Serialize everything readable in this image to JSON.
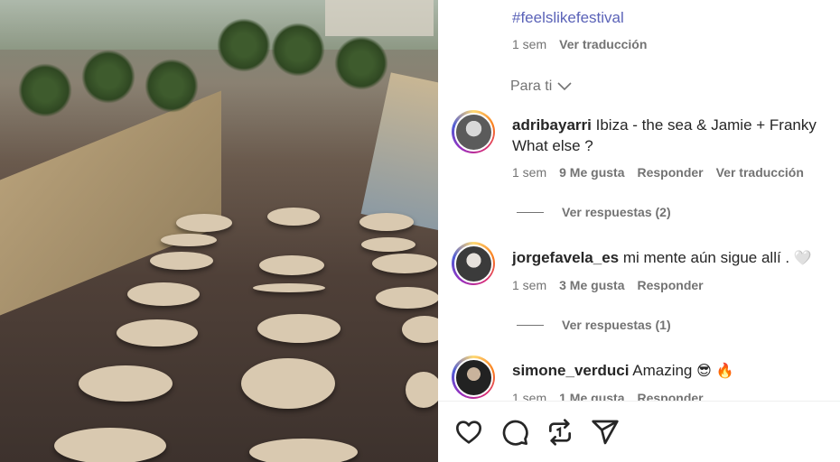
{
  "post": {
    "hashtag": "#feelslikefestival",
    "time": "1 sem",
    "see_translation": "Ver traducción"
  },
  "section_label": "Para ti",
  "comments": [
    {
      "user": "adribayarri",
      "text": "Ibiza - the sea & Jamie + Franky What else ?",
      "time": "1 sem",
      "likes": "9 Me gusta",
      "reply": "Responder",
      "translate": "Ver traducción",
      "view_replies": "Ver respuestas (2)"
    },
    {
      "user": "jorgefavela_es",
      "text": "mi mente aún sigue allí .",
      "emoji": "🤍",
      "time": "1 sem",
      "likes": "3 Me gusta",
      "reply": "Responder",
      "view_replies": "Ver respuestas (1)"
    },
    {
      "user": "simone_verduci",
      "text": "Amazing",
      "emoji": "😎 🔥",
      "time": "1 sem",
      "likes": "1 Me gusta",
      "reply": "Responder"
    }
  ],
  "actions": {
    "like": "heart-icon",
    "comment": "comment-icon",
    "repost": "repost-icon",
    "share": "share-icon"
  }
}
